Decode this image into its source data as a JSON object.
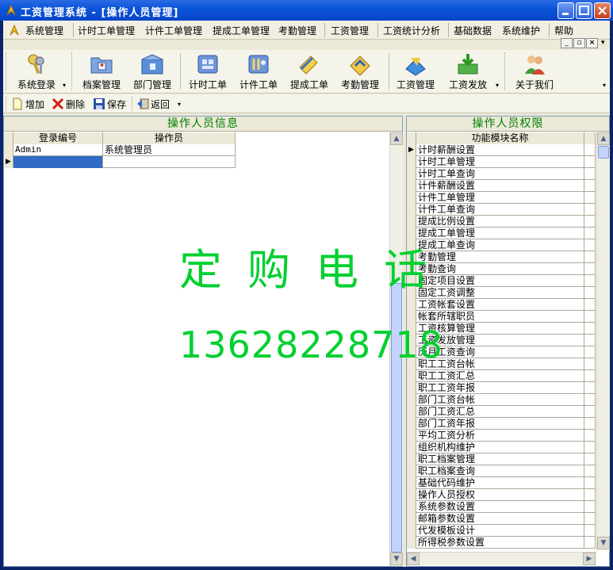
{
  "window": {
    "title": "工资管理系统 - [操作人员管理]"
  },
  "menu": [
    "系统管理",
    "计时工单管理",
    "计件工单管理",
    "提成工单管理",
    "考勤管理",
    "工资管理",
    "工资统计分析",
    "基础数据",
    "系统维护",
    "帮助"
  ],
  "toolbar": {
    "buttons": [
      {
        "label": "系统登录",
        "icon": "keys-icon"
      },
      {
        "label": "档案管理",
        "icon": "folder-icon"
      },
      {
        "label": "部门管理",
        "icon": "department-icon"
      },
      {
        "label": "计时工单",
        "icon": "timesheet-icon"
      },
      {
        "label": "计件工单",
        "icon": "piecework-icon"
      },
      {
        "label": "提成工单",
        "icon": "commission-icon"
      },
      {
        "label": "考勤管理",
        "icon": "attendance-icon"
      },
      {
        "label": "工资管理",
        "icon": "salary-icon"
      },
      {
        "label": "工资发放",
        "icon": "payout-icon"
      },
      {
        "label": "关于我们",
        "icon": "about-icon"
      }
    ]
  },
  "actions": {
    "add": "增加",
    "delete": "删除",
    "save": "保存",
    "back": "返回"
  },
  "left_panel": {
    "title": "操作人员信息",
    "columns": [
      "登录编号",
      "操作员"
    ],
    "rows": [
      [
        "Admin",
        "系统管理员"
      ],
      [
        "",
        ""
      ]
    ]
  },
  "right_panel": {
    "title": "操作人员权限",
    "column": "功能模块名称",
    "rows": [
      "计时薪酬设置",
      "计时工单管理",
      "计时工单查询",
      "计件薪酬设置",
      "计件工单管理",
      "计件工单查询",
      "提成比例设置",
      "提成工单管理",
      "提成工单查询",
      "考勤管理",
      "考勤查询",
      "固定项目设置",
      "固定工资调整",
      "工资帐套设置",
      "帐套所辖职员",
      "工资核算管理",
      "工资发放管理",
      "历月工资查询",
      "职工工资台帐",
      "职工工资汇总",
      "职工工资年报",
      "部门工资台帐",
      "部门工资汇总",
      "部门工资年报",
      "平均工资分析",
      "组织机构维护",
      "职工档案管理",
      "职工档案查询",
      "基础代码维护",
      "操作人员授权",
      "系统参数设置",
      "邮箱参数设置",
      "代发模板设计",
      "所得税参数设置"
    ]
  },
  "watermark": {
    "line1": "定购电话",
    "line2": "13628228718"
  },
  "colors": {
    "title_bar": "#0b55d8",
    "panel_header_text": "#008000",
    "watermark": "#00d030"
  }
}
